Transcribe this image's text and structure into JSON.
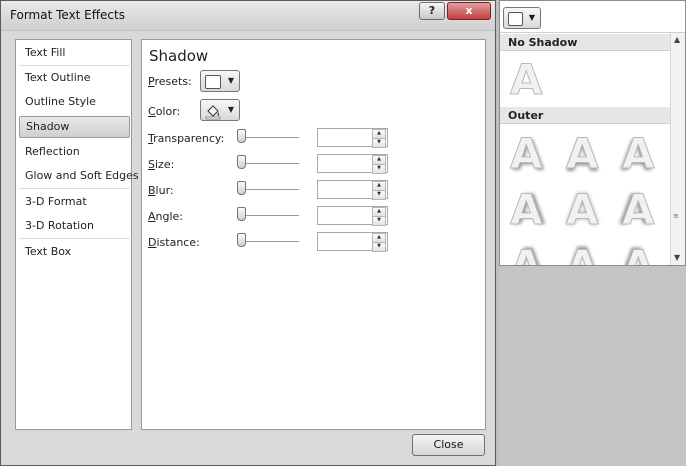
{
  "window": {
    "title": "Format Text Effects",
    "help_label": "?",
    "close_label": "x"
  },
  "categories": [
    {
      "label": "Text Fill"
    },
    {
      "label": "Text Outline"
    },
    {
      "label": "Outline Style"
    },
    {
      "label": "Shadow",
      "selected": true
    },
    {
      "label": "Reflection"
    },
    {
      "label": "Glow and Soft Edges"
    },
    {
      "label": "3-D Format"
    },
    {
      "label": "3-D Rotation"
    },
    {
      "label": "Text Box"
    }
  ],
  "panel": {
    "title": "Shadow",
    "presets_label": "Presets:",
    "color_label": "Color:",
    "sliders": [
      {
        "label": "Transparency:",
        "value": ""
      },
      {
        "label": "Size:",
        "value": ""
      },
      {
        "label": "Blur:",
        "value": ""
      },
      {
        "label": "Angle:",
        "value": ""
      },
      {
        "label": "Distance:",
        "value": ""
      }
    ],
    "close_button": "Close"
  },
  "gallery": {
    "no_shadow_header": "No Shadow",
    "outer_header": "Outer",
    "glyph": "A"
  }
}
